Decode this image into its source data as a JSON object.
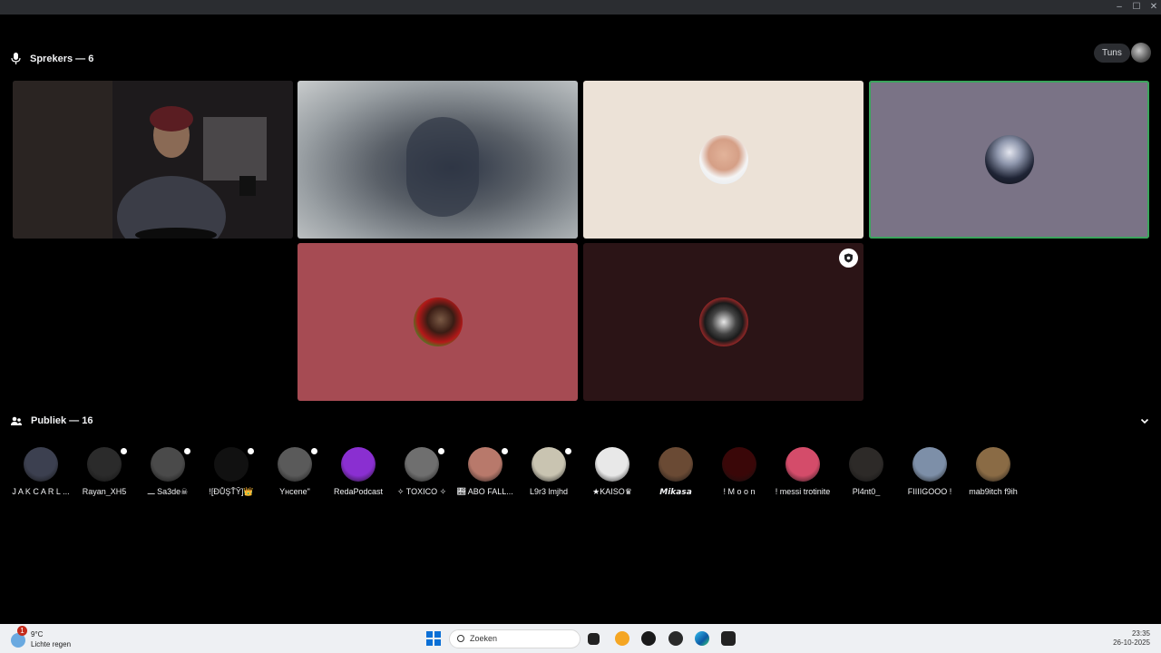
{
  "window": {
    "controls": {
      "minimize": "–",
      "maximize": "☐",
      "close": "✕"
    }
  },
  "speakers": {
    "header": "Sprekers — 6",
    "icon": "microphone-icon"
  },
  "top_right": {
    "button_label": "Tuns",
    "avatar": "user-avatar"
  },
  "tiles": [
    {
      "type": "video",
      "description": ""
    },
    {
      "type": "video-blurred"
    },
    {
      "type": "avatar",
      "color": "#ece2d7"
    },
    {
      "type": "avatar",
      "color": "#7a7386",
      "speaking": true
    },
    {
      "type": "avatar",
      "color": "#a64b53"
    },
    {
      "type": "avatar",
      "color": "#2b1416",
      "badge": "shield-icon"
    }
  ],
  "audience": {
    "header": "Publiek — 16",
    "icon": "audience-icon",
    "collapse_icon": "chevron-down-icon",
    "members": [
      {
        "name": "J A K C A R L ...",
        "color": "#3c4050",
        "badge": false
      },
      {
        "name": "Rayan_XH5",
        "color": "#2b2b2b",
        "badge": true
      },
      {
        "name": "ـــ Sa3de☠",
        "color": "#4a4a4a",
        "badge": true
      },
      {
        "name": "![ĐŮŞŤŶ]👑",
        "color": "#111111",
        "badge": true
      },
      {
        "name": "Yнcene\"",
        "color": "#5a5a5a",
        "badge": true
      },
      {
        "name": "RedaPodcast",
        "color": "#8a2fd1",
        "badge": false
      },
      {
        "name": "✧ TOXICO ✧",
        "color": "#6f6f6f",
        "badge": true
      },
      {
        "name": "𝍝 ABO FALL...",
        "color": "#b8796b",
        "badge": true
      },
      {
        "name": "L9r3 lmjhd",
        "color": "#c9c4b1",
        "badge": true
      },
      {
        "name": "★KAISO♛",
        "color": "#e8e8e8",
        "badge": false
      },
      {
        "name": "𝙈𝙞𝙠𝙖𝙨𝙖",
        "color": "#6a4a34",
        "badge": false
      },
      {
        "name": "! M o o n",
        "color": "#3a0708",
        "badge": false
      },
      {
        "name": "! messi trotinite",
        "color": "#d44c6a",
        "badge": false
      },
      {
        "name": "Pl4nt0_",
        "color": "#2d2a28",
        "badge": false
      },
      {
        "name": "FIIIIGOOO !",
        "color": "#7d8fa8",
        "badge": false
      },
      {
        "name": "mab9itch f9ih",
        "color": "#8a6b45",
        "badge": false
      }
    ]
  },
  "taskbar": {
    "weather_temp": "9°C",
    "weather_desc": "Lichte regen",
    "weather_alert": "1",
    "search_placeholder": "Zoeken",
    "time": "23:35",
    "date": "26-10-2025"
  }
}
